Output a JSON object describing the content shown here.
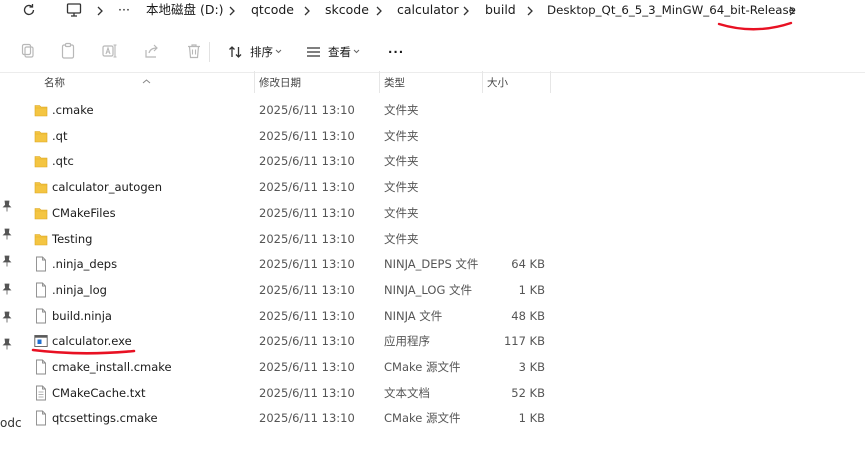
{
  "address_bar": {
    "icon": "monitor-icon",
    "ellipsis": "···",
    "segments": [
      "本地磁盘 (D:)",
      "qtcode",
      "skcode",
      "calculator",
      "build",
      "Desktop_Qt_6_5_3_MinGW_64_bit-Release"
    ]
  },
  "toolbar": {
    "sort_label": "排序",
    "view_label": "查看",
    "more_label": "···"
  },
  "columns": {
    "name": "名称",
    "date": "修改日期",
    "type": "类型",
    "size": "大小"
  },
  "files": [
    {
      "name": ".cmake",
      "date": "2025/6/11 13:10",
      "type": "文件夹",
      "size": "",
      "icon": "folder-icon"
    },
    {
      "name": ".qt",
      "date": "2025/6/11 13:10",
      "type": "文件夹",
      "size": "",
      "icon": "folder-icon"
    },
    {
      "name": ".qtc",
      "date": "2025/6/11 13:10",
      "type": "文件夹",
      "size": "",
      "icon": "folder-icon"
    },
    {
      "name": "calculator_autogen",
      "date": "2025/6/11 13:10",
      "type": "文件夹",
      "size": "",
      "icon": "folder-icon"
    },
    {
      "name": "CMakeFiles",
      "date": "2025/6/11 13:10",
      "type": "文件夹",
      "size": "",
      "icon": "folder-icon"
    },
    {
      "name": "Testing",
      "date": "2025/6/11 13:10",
      "type": "文件夹",
      "size": "",
      "icon": "folder-icon"
    },
    {
      "name": ".ninja_deps",
      "date": "2025/6/11 13:10",
      "type": "NINJA_DEPS 文件",
      "size": "64 KB",
      "icon": "file-icon"
    },
    {
      "name": ".ninja_log",
      "date": "2025/6/11 13:10",
      "type": "NINJA_LOG 文件",
      "size": "1 KB",
      "icon": "file-icon"
    },
    {
      "name": "build.ninja",
      "date": "2025/6/11 13:10",
      "type": "NINJA 文件",
      "size": "48 KB",
      "icon": "file-icon"
    },
    {
      "name": "calculator.exe",
      "date": "2025/6/11 13:10",
      "type": "应用程序",
      "size": "117 KB",
      "icon": "exe-icon"
    },
    {
      "name": "cmake_install.cmake",
      "date": "2025/6/11 13:10",
      "type": "CMake 源文件",
      "size": "3 KB",
      "icon": "file-icon"
    },
    {
      "name": "CMakeCache.txt",
      "date": "2025/6/11 13:10",
      "type": "文本文档",
      "size": "52 KB",
      "icon": "text-file-icon"
    },
    {
      "name": "qtcsettings.cmake",
      "date": "2025/6/11 13:10",
      "type": "CMake 源文件",
      "size": "1 KB",
      "icon": "file-icon"
    }
  ],
  "left_edge_text": "odc",
  "accent_colors": {
    "folder": "#f4c542",
    "annotation": "#e81123",
    "exe": "#1f6fd1"
  }
}
